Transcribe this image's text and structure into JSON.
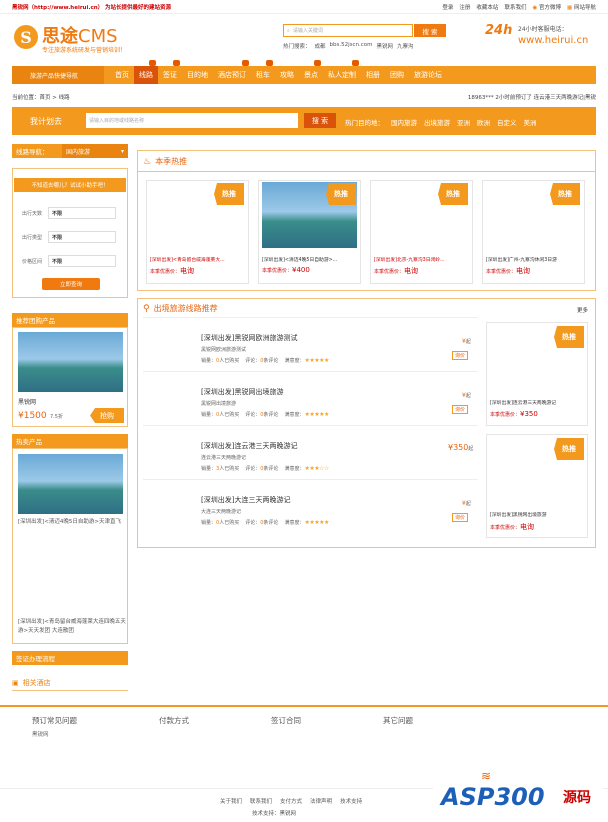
{
  "topbar": {
    "left": "黑锐网（http://www.heirui.cn） 为站长提供最好的建站资源",
    "links": [
      "登录",
      "注册",
      "收藏本站",
      "联系我们",
      "官方微博",
      "网站导航"
    ]
  },
  "header": {
    "logo_mark": "S",
    "logo_name": "思途",
    "logo_cms": "CMS",
    "logo_sub": "专注旅游系统研发与营销培训！",
    "search_placeholder": "请输入关键词",
    "search_btn": "搜 索",
    "hot_label": "热门搜索：",
    "hot_words": [
      "成都",
      "bbs.52jscn.com",
      "黑锐网",
      "九寨沟"
    ],
    "badge": "24h",
    "tel_label": "24小时客服电话：",
    "tel": "www.heirui.cn"
  },
  "nav": {
    "category": "旅游产品快捷导航",
    "items": [
      "首页",
      "线路",
      "签证",
      "目的地",
      "酒店预订",
      "租车",
      "攻略",
      "景点",
      "私人定制",
      "相册",
      "团购",
      "旅游论坛"
    ],
    "active": 1
  },
  "breadcrumb": {
    "left": "当前位置：首页 > 线路",
    "right": "18963*** 2小时前预订了 连云港三天两晚游记|黑锐"
  },
  "plan": {
    "title": "我计划去",
    "placeholder": "请输入目的地或线路名称",
    "btn": "搜 索",
    "hot_label": "热门目的地：",
    "dests": [
      "国内旅游",
      "出境旅游",
      "亚洲",
      "欧洲",
      "自定义",
      "美洲"
    ]
  },
  "left": {
    "line_nav": "线路导航：",
    "line_nav_value": "国内旅游",
    "quiz_title": "不知道去哪儿？试试小助手吧！",
    "fields": [
      {
        "label": "出行天数",
        "value": "不限"
      },
      {
        "label": "出行类型",
        "value": "不限"
      },
      {
        "label": "价格区间",
        "value": "不限"
      }
    ],
    "query_btn": "立即查询",
    "recommend_title": "推荐团购产品",
    "recommend_name": "黑锐网",
    "recommend_price": "¥1500",
    "recommend_discount": "7.5折",
    "recommend_btn": "抢购",
    "hotsale_title": "热卖产品",
    "hotsale_1": "[深圳出发]<清迈4晚5日自助游>天津直飞",
    "hotsale_2": "[深圳出发]<青岛留台威海蓬莱大连四晚五天游>天天发团 大连散团",
    "visa_title": "签证办理流程",
    "hotel_title": "相关酒店"
  },
  "season": {
    "title": "本季热推",
    "hot_tag": "热推",
    "price_label": "本季优惠价：",
    "cards": [
      {
        "title": "[深圳出发]<青岛留台威海蓬莱大...",
        "price": "电询",
        "photo": false
      },
      {
        "title": "[深圳出发]<清迈4晚5日自助游>...",
        "price": "¥400",
        "photo": true
      },
      {
        "title": "[深圳出发]北京-九寨沟3日闭岭...",
        "price": "电询",
        "photo": false
      },
      {
        "title": "[深圳出发]广州-九寨沟休闲3日游",
        "price": "电询",
        "photo": false
      }
    ]
  },
  "outbound": {
    "title": "出境旅游线路推荐",
    "more": "更多",
    "sales_label": "销量：",
    "people": "人已购买",
    "comments_label": "评论：",
    "comments_unit": "条评论",
    "satisfaction": "满意度：",
    "qi": "起",
    "rows": [
      {
        "title": "[深圳出发]黑锐网欧洲旅游测试",
        "sub": "黑锐网欧洲旅游测试",
        "sales": "0",
        "comments": "0",
        "stars": "★★★★★",
        "price": "¥",
        "tag": "询价"
      },
      {
        "title": "[深圳出发]黑锐网出境旅游",
        "sub": "黑锐网出境旅游",
        "sales": "0",
        "comments": "0",
        "stars": "★★★★★",
        "price": "¥",
        "tag": "询价"
      },
      {
        "title": "[深圳出发]连云港三天两晚游记",
        "sub": "连云港三天两晚游记",
        "sales": "3",
        "comments": "0",
        "stars": "★★★☆☆",
        "price": "¥350",
        "tag": ""
      },
      {
        "title": "[深圳出发]大连三天两晚游记",
        "sub": "大连三天两晚游记",
        "sales": "0",
        "comments": "0",
        "stars": "★★★★★",
        "price": "¥",
        "tag": "询价"
      }
    ],
    "side": [
      {
        "title": "[深圳出发]连云港三天两晚游记",
        "price": "¥350"
      },
      {
        "title": "[深圳出发]黑锐网出境旅游",
        "price": "电询"
      }
    ]
  },
  "footer": {
    "cols": [
      "预订常见问题",
      "付款方式",
      "签订合同",
      "其它问题"
    ],
    "col1_sub": "黑锐网",
    "links": [
      "关于我们",
      "联系我们",
      "支付方式",
      "法律声明",
      "技术支持"
    ],
    "support": "技术支持：黑锐网",
    "watermark": "ASP300",
    "watermark_cn": "源码"
  }
}
